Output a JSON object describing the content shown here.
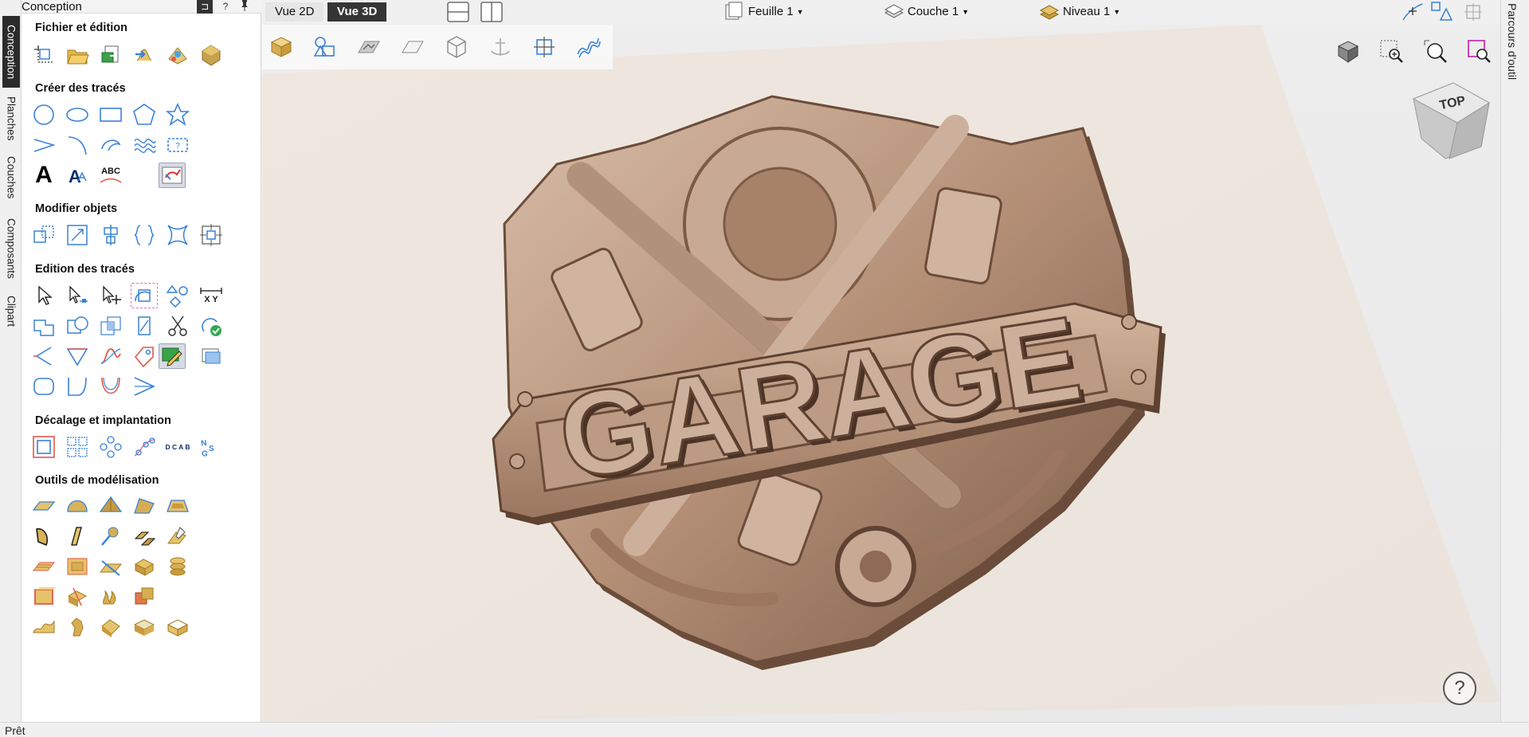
{
  "vertical_tabs": [
    {
      "label": "Conception",
      "active": true
    },
    {
      "label": "Planches",
      "active": false
    },
    {
      "label": "Couches",
      "active": false
    },
    {
      "label": "Composants",
      "active": false
    },
    {
      "label": "Clipart",
      "active": false
    }
  ],
  "panel": {
    "title": "Conception",
    "pin_button": "⊐",
    "help_button": "?",
    "pushpin_button": "📌",
    "sections": {
      "file": "Fichier et édition",
      "create": "Créer des tracés",
      "modify": "Modifier objets",
      "edit": "Edition des tracés",
      "offset": "Décalage et implantation",
      "modeling": "Outils de modélisation"
    },
    "edit_xy_label": "X Y",
    "abc_label": "ABC",
    "offset_grid_label": "D C A B",
    "text_big_A": "A"
  },
  "topbar": {
    "tab_2d": "Vue 2D",
    "tab_3d": "Vue 3D",
    "sheet": "Feuille 1",
    "layer": "Couche 1",
    "level": "Niveau 1"
  },
  "viewport": {
    "model_text": "GARAGE",
    "viewcube_label": "TOP",
    "help_label": "?"
  },
  "right_tab": {
    "label": "Parcours d'outil"
  },
  "status": {
    "text": "Prêt"
  },
  "colors": {
    "icon_blue": "#3b82d6",
    "model_bronze": "#b48f76",
    "active_tab": "#353535"
  }
}
